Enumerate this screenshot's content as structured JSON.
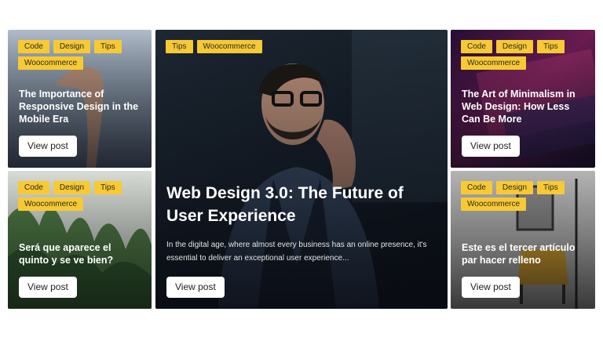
{
  "cards": {
    "top_left": {
      "tags": [
        "Code",
        "Design",
        "Tips",
        "Woocommerce"
      ],
      "title": "The Importance of Responsive Design in the Mobile Era",
      "button": "View post"
    },
    "bottom_left": {
      "tags": [
        "Code",
        "Design",
        "Tips",
        "Woocommerce"
      ],
      "title": "Será que aparece el quinto y se ve bien?",
      "button": "View post"
    },
    "featured": {
      "tags": [
        "Tips",
        "Woocommerce"
      ],
      "title": "Web Design 3.0: The Future of User Experience",
      "excerpt": "In the digital age, where almost every business has an online presence, it's essential to deliver an exceptional user experience...",
      "button": "View post"
    },
    "top_right": {
      "tags": [
        "Code",
        "Design",
        "Tips",
        "Woocommerce"
      ],
      "title": "The Art of Minimalism in Web Design: How Less Can Be More",
      "button": "View post"
    },
    "bottom_right": {
      "tags": [
        "Code",
        "Design",
        "Tips",
        "Woocommerce"
      ],
      "title": "Este es el tercer artículo par hacer relleno",
      "button": "View post"
    }
  },
  "colors": {
    "tag_bg": "#f7c934",
    "button_bg": "#ffffff"
  }
}
